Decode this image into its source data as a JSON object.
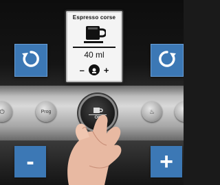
{
  "display": {
    "drink_name": "Espresso corse",
    "volume": "40 ml",
    "minus_symbol": "–",
    "plus_symbol": "+",
    "cup_icon": "cup-icon",
    "aroma_icon": "aroma-icon"
  },
  "left_buttons": [
    {
      "symbol": "⏻",
      "icon": "power-icon"
    },
    {
      "symbol": "Prog",
      "icon": "prog-label"
    }
  ],
  "right_buttons": [
    {
      "symbol": "♨",
      "icon": "steam-icon"
    }
  ],
  "knob": {
    "label": "OK",
    "icon": "cup-icon"
  },
  "overlay_controls": {
    "rotate_left_icon": "rotate-ccw-icon",
    "rotate_right_icon": "rotate-cw-icon",
    "minus_label": "-",
    "plus_label": "+"
  },
  "colors": {
    "overlay_blue": "#3c78b5",
    "screen_bg": "#f4f4f4"
  }
}
